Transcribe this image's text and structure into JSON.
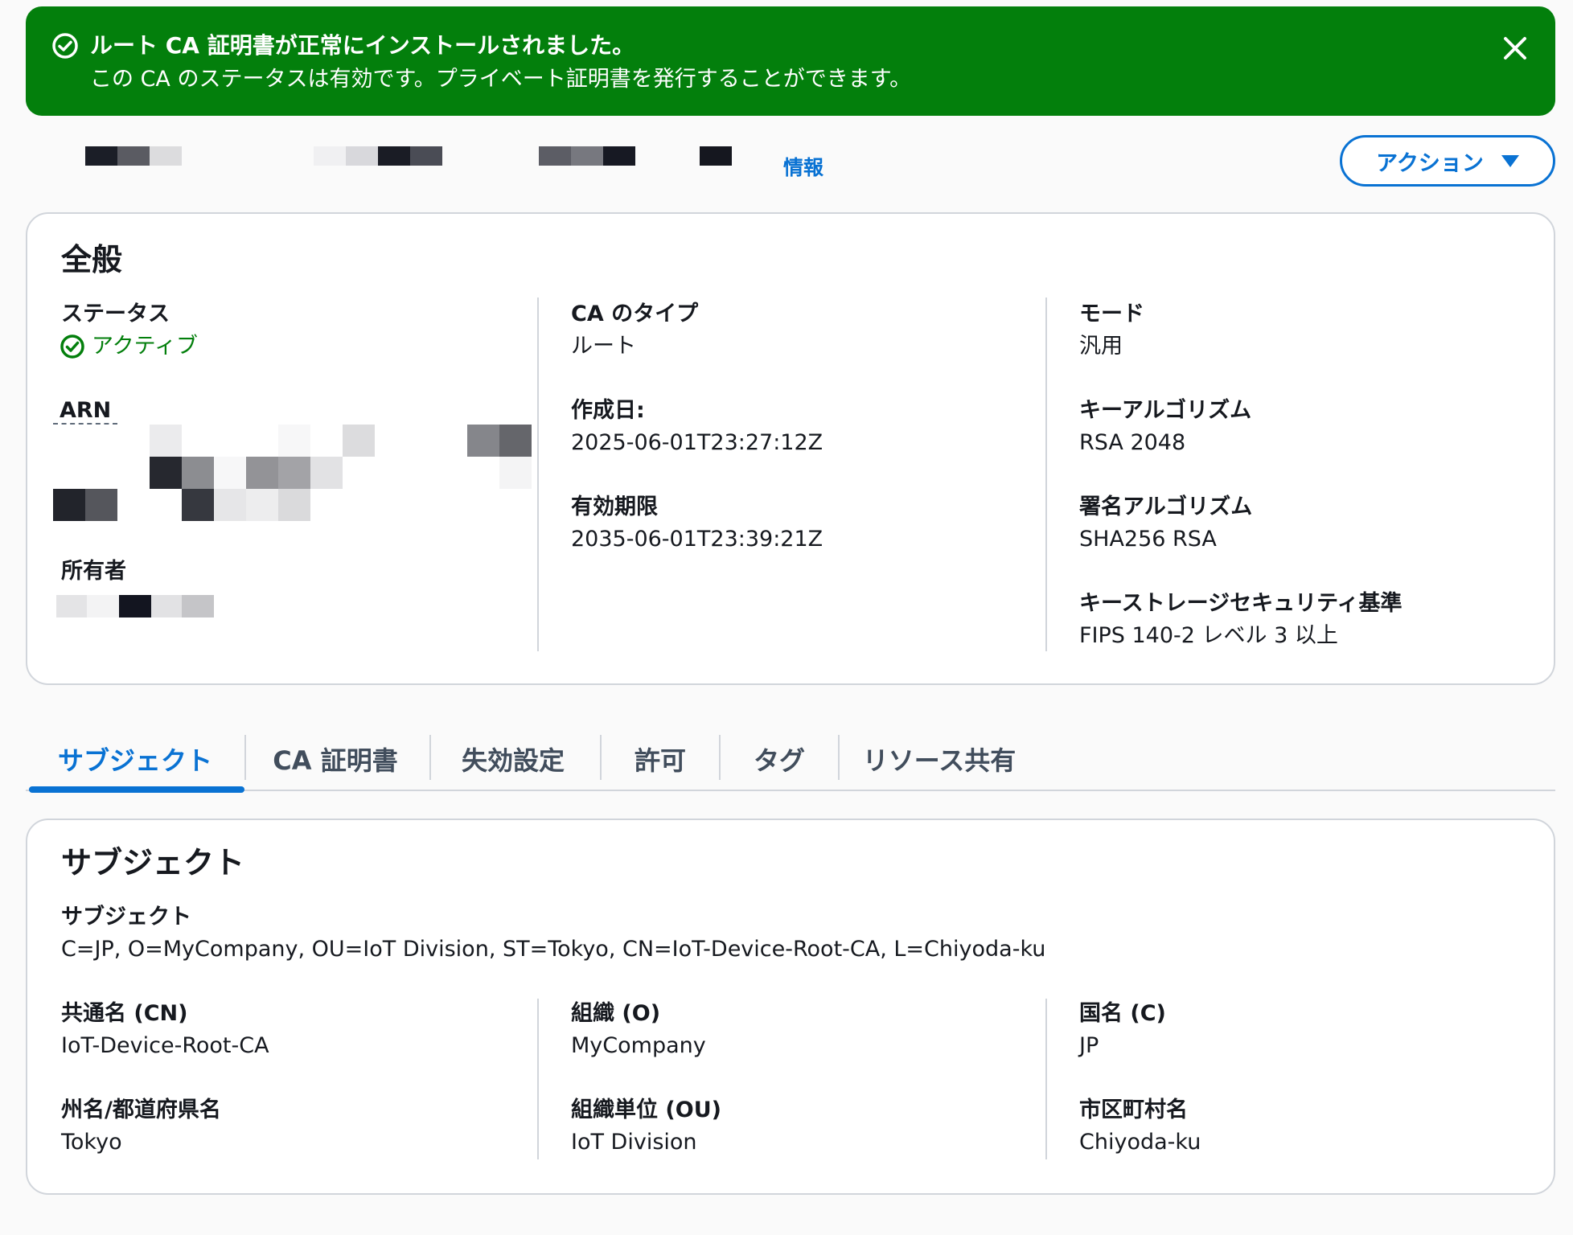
{
  "flash": {
    "title": "ルート CA 証明書が正常にインストールされました。",
    "message": "この CA のステータスは有効です。プライベート証明書を発行することができます。",
    "color": "#037f0c"
  },
  "header": {
    "info_link": "情報",
    "action_button": "アクション"
  },
  "general": {
    "title": "全般",
    "status_label": "ステータス",
    "status_value": "アクティブ",
    "arn_label": "ARN",
    "owner_label": "所有者",
    "ca_type_label": "CA のタイプ",
    "ca_type_value": "ルート",
    "created_label": "作成日:",
    "created_value": "2025-06-01T23:27:12Z",
    "expires_label": "有効期限",
    "expires_value": "2035-06-01T23:39:21Z",
    "mode_label": "モード",
    "mode_value": "汎用",
    "key_algo_label": "キーアルゴリズム",
    "key_algo_value": "RSA 2048",
    "sign_algo_label": "署名アルゴリズム",
    "sign_algo_value": "SHA256 RSA",
    "key_storage_label": "キーストレージセキュリティ基準",
    "key_storage_value": "FIPS 140-2 レベル 3 以上"
  },
  "tabs": [
    "サブジェクト",
    "CA 証明書",
    "失効設定",
    "許可",
    "タグ",
    "リソース共有"
  ],
  "subject": {
    "title": "サブジェクト",
    "subject_label": "サブジェクト",
    "subject_value": "C=JP, O=MyCompany, OU=IoT Division, ST=Tokyo, CN=IoT-Device-Root-CA, L=Chiyoda-ku",
    "cn_label": "共通名 (CN)",
    "cn_value": "IoT-Device-Root-CA",
    "o_label": "組織 (O)",
    "o_value": "MyCompany",
    "c_label": "国名 (C)",
    "c_value": "JP",
    "st_label": "州名/都道府県名",
    "st_value": "Tokyo",
    "ou_label": "組織単位 (OU)",
    "ou_value": "IoT Division",
    "l_label": "市区町村名",
    "l_value": "Chiyoda-ku"
  },
  "colors": {
    "accent": "#0972d3",
    "success": "#037f0c",
    "text": "#16191f",
    "border": "#d1d5db"
  }
}
